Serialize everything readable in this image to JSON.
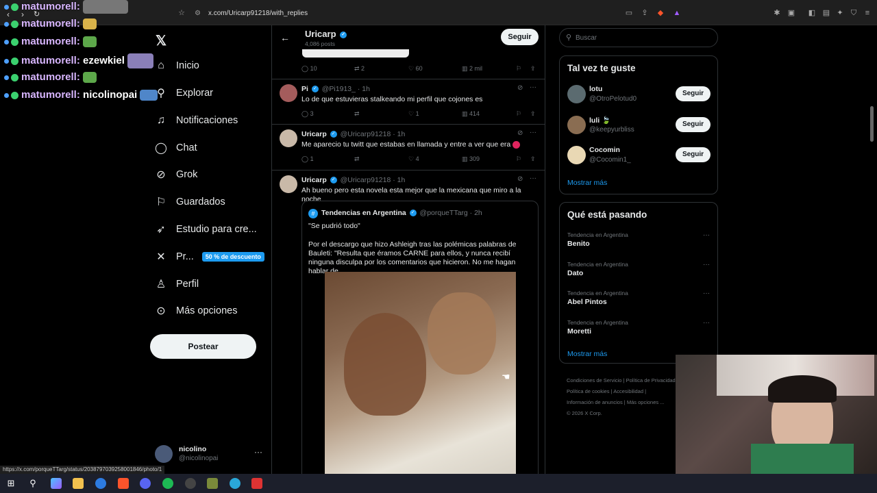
{
  "browser": {
    "url": "x.com/Uricarp91218/with_replies",
    "status_url": "https://x.com/porqueTTarg/status/2038797039258001846/photo/1"
  },
  "twitch_chat": [
    {
      "user": "matumorell:",
      "msg": ""
    },
    {
      "user": "matumorell:",
      "msg": ""
    },
    {
      "user": "matumorell:",
      "msg": ""
    },
    {
      "user": "matumorell:",
      "msg": "ezewkiel"
    },
    {
      "user": "matumorell:",
      "msg": ""
    },
    {
      "user": "matumorell:",
      "msg": "nicolinopai"
    }
  ],
  "nav": {
    "items": [
      {
        "label": "Inicio",
        "icon": "home-icon"
      },
      {
        "label": "Explorar",
        "icon": "search-icon"
      },
      {
        "label": "Notificaciones",
        "icon": "bell-icon"
      },
      {
        "label": "Chat",
        "icon": "chat-icon"
      },
      {
        "label": "Grok",
        "icon": "grok-icon"
      },
      {
        "label": "Guardados",
        "icon": "bookmark-icon"
      },
      {
        "label": "Estudio para cre...",
        "icon": "rocket-icon"
      },
      {
        "label": "Pr...",
        "icon": "x-icon"
      },
      {
        "label": "Perfil",
        "icon": "person-icon"
      },
      {
        "label": "Más opciones",
        "icon": "more-circle-icon"
      }
    ],
    "premium_badge": "50 % de descuento",
    "post_button": "Postear",
    "account": {
      "name": "nicolino",
      "handle": "@nicolinopai"
    }
  },
  "profile_header": {
    "name": "Uricarp",
    "posts": "4,086 posts",
    "follow": "Seguir"
  },
  "tweets": [
    {
      "stats": {
        "replies": "10",
        "retweets": "2",
        "likes": "60",
        "views": "2 mil"
      }
    },
    {
      "name": "Pi",
      "handle": "@Pi1913_",
      "time": "· 1h",
      "text": "Lo de que estuvieras stalkeando mi perfil que cojones es",
      "stats": {
        "replies": "3",
        "retweets": "",
        "likes": "1",
        "views": "414"
      }
    },
    {
      "name": "Uricarp",
      "handle": "@Uricarp91218",
      "time": "· 1h",
      "text": "Me aparecio tu twitt que estabas en llamada y entre a ver que era",
      "stats": {
        "replies": "1",
        "retweets": "",
        "likes": "4",
        "views": "309"
      }
    },
    {
      "name": "Uricarp",
      "handle": "@Uricarp91218",
      "time": "· 1h",
      "text": "Ah bueno pero esta novela esta mejor que la mexicana que miro a la noche"
    }
  ],
  "quote": {
    "name": "Tendencias en Argentina",
    "handle": "@porqueTTarg",
    "time": "· 2h",
    "line1": "\"Se pudrió todo\"",
    "line2": "Por el descargo que hizo Ashleigh tras las polémicas palabras de Bauleti: \"Resulta que éramos CARNE para ellos, y nunca recibí ninguna disculpa por los comentarios que hicieron. No me hagan hablar de ..."
  },
  "search": {
    "placeholder": "Buscar"
  },
  "suggestions": {
    "title": "Tal vez te guste",
    "items": [
      {
        "name": "lotu",
        "handle": "@OtroPelotud0",
        "button": "Seguir"
      },
      {
        "name": "luli 🍃",
        "handle": "@keepyurbliss",
        "button": "Seguir"
      },
      {
        "name": "Cocomin",
        "handle": "@Cocomin1_",
        "button": "Seguir"
      }
    ],
    "more": "Mostrar más"
  },
  "trends": {
    "title": "Qué está pasando",
    "items": [
      {
        "context": "Tendencia en Argentina",
        "name": "Benito"
      },
      {
        "context": "Tendencia en Argentina",
        "name": "Dato"
      },
      {
        "context": "Tendencia en Argentina",
        "name": "Abel Pintos"
      },
      {
        "context": "Tendencia en Argentina",
        "name": "Moretti"
      }
    ],
    "more": "Mostrar más"
  },
  "footer": {
    "l1a": "Condiciones de Servicio",
    "l1b": "Política de Privacidad",
    "l2a": "Política de cookies",
    "l2b": "Accesibilidad",
    "l3a": "Información de anuncios",
    "l3b": "Más opciones ...",
    "copy": "© 2026 X Corp."
  },
  "colors": {
    "accent": "#1d9bf0",
    "background": "#000000",
    "chat_name": "#d8b6ff"
  }
}
